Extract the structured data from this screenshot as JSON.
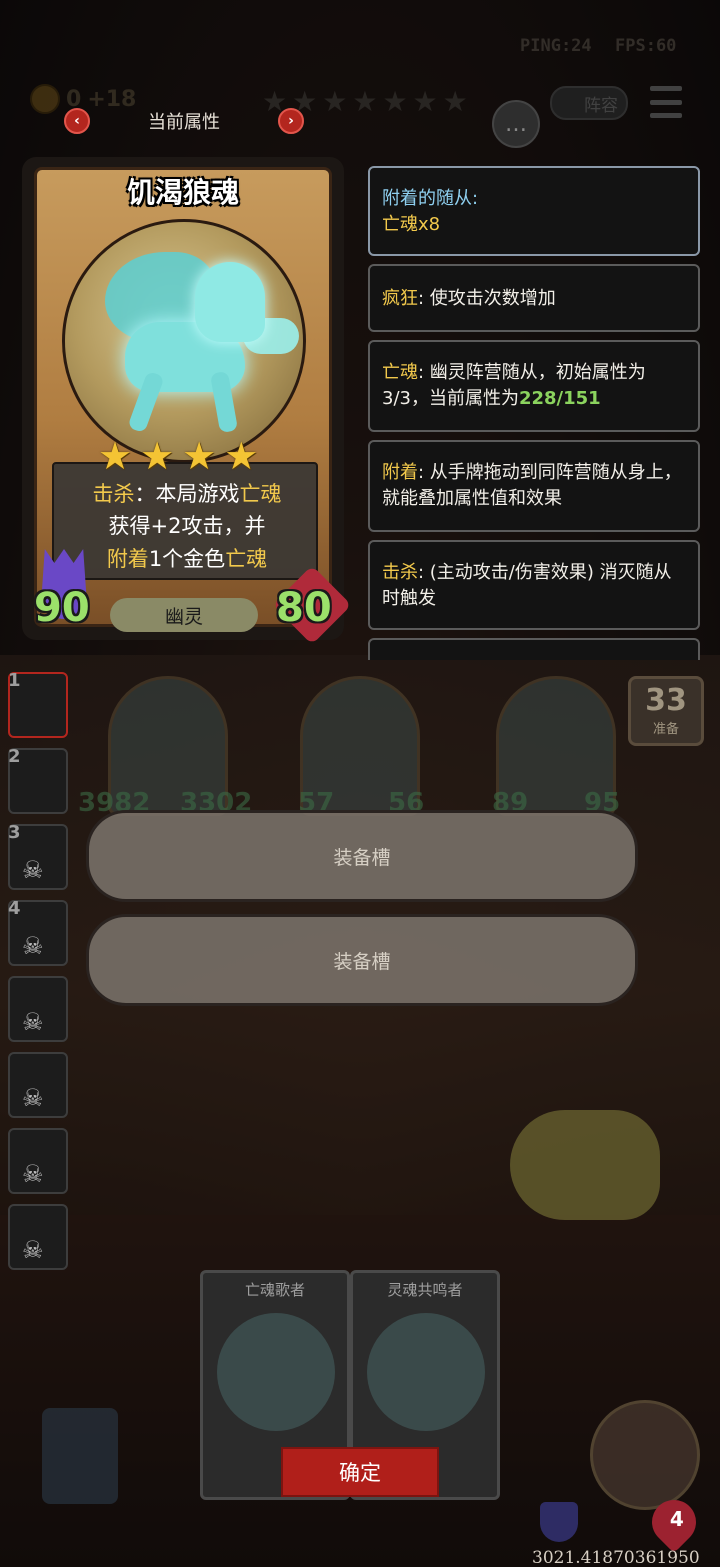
{
  "hud": {
    "ping": "PING:24",
    "fps": "FPS:60",
    "gold": "0",
    "gold_income": "+18",
    "lineup_label": "阵容"
  },
  "panel": {
    "title": "当前属性"
  },
  "card": {
    "name": "饥渴狼魂",
    "stars": [
      "★",
      "★",
      "★",
      "★"
    ],
    "desc": {
      "line1_a": "击杀",
      "line1_b": "：本局游戏",
      "line1_c": "亡魂",
      "line2": "获得+2攻击，并",
      "line3_a": "附着",
      "line3_b": "1个金色",
      "line3_c": "亡魂"
    },
    "attack": "90",
    "health": "80",
    "tribe": "幽灵"
  },
  "keywords": {
    "attached_label": "附着的随从:",
    "attached_value": "亡魂x8",
    "frenzy_key": "疯狂",
    "frenzy_text": ": 使攻击次数增加",
    "soul_key": "亡魂",
    "soul_text1": ": 幽灵阵营随从，初始属性为",
    "soul_text2": "3/3，当前属性为",
    "soul_value": "228/151",
    "attach_key": "附着",
    "attach_text": ": 从手牌拖动到同阵营随从身上，就能叠加属性值和效果",
    "kill_key": "击杀",
    "kill_text": ": (主动攻击/伤害效果) 消灭随从时触发"
  },
  "board": {
    "slots": [
      "1",
      "2",
      "3",
      "4"
    ],
    "ready_count": "33",
    "ready_label": "准备",
    "equip_slot_1": "装备槽",
    "equip_slot_2": "装备槽",
    "minion_stats": [
      "3982",
      "3302",
      "57",
      "56",
      "89",
      "95"
    ]
  },
  "hand": {
    "card1_title": "亡魂歌者",
    "card2_title": "灵魂共鸣者",
    "confirm": "确定"
  },
  "player": {
    "life": "4"
  },
  "footer_code": "3021.41870361950",
  "colors": {
    "accent_red": "#b01f1a",
    "stat_green": "#9be06a",
    "keyword_gold": "#f2c94c"
  }
}
